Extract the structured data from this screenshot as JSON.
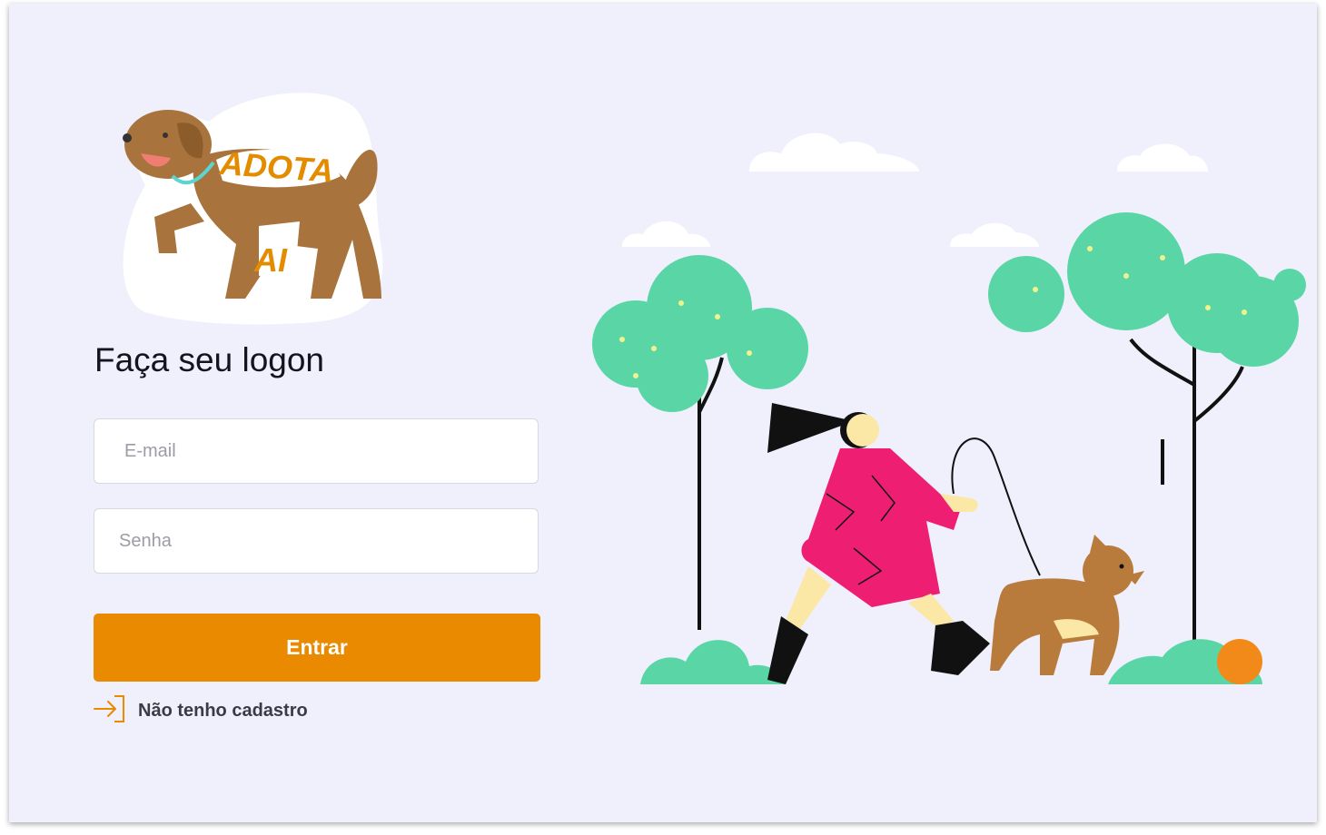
{
  "logo": {
    "line1": "ADOTA",
    "line2": "AI"
  },
  "login": {
    "title": "Faça seu logon",
    "email_placeholder": "E-mail",
    "password_placeholder": "Senha",
    "submit_label": "Entrar",
    "register_link": "Não tenho cadastro"
  },
  "colors": {
    "background": "#f0effc",
    "accent": "#ea8a00",
    "dog_brown": "#a8733c",
    "tree_green": "#5ad6a6",
    "dress_pink": "#ee1e73"
  },
  "icons": {
    "register": "log-in-arrow-icon"
  }
}
